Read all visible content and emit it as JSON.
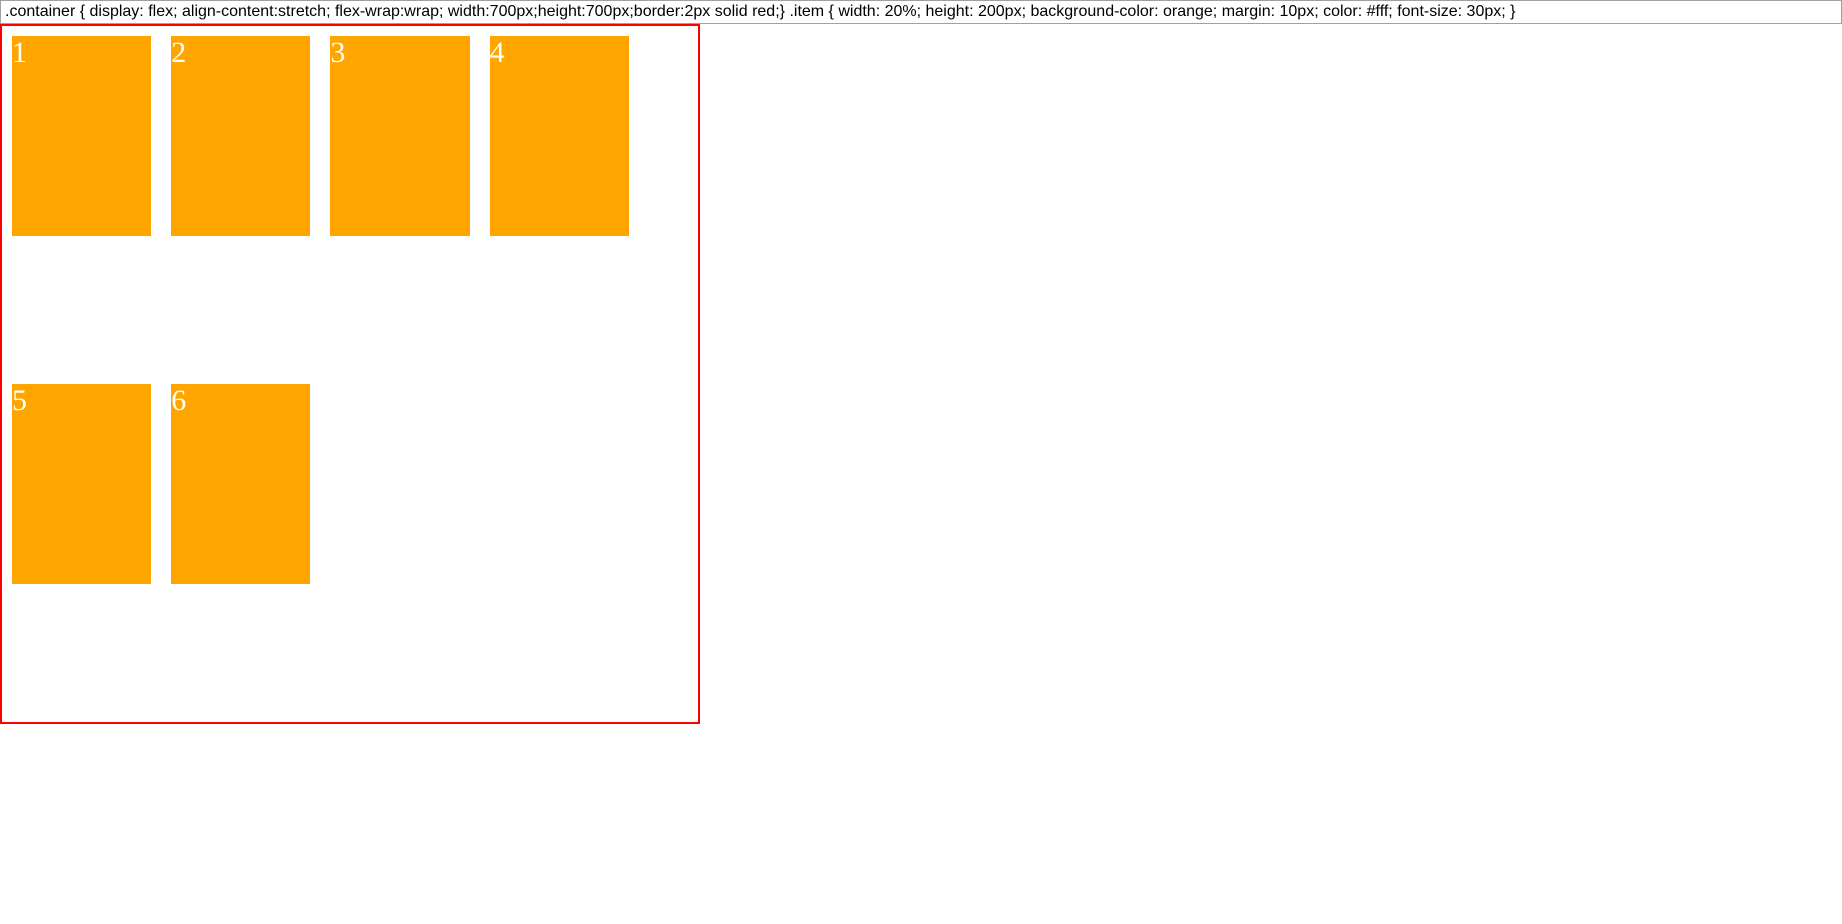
{
  "css_input": ".container { display: flex; align-content:stretch; flex-wrap:wrap; width:700px;height:700px;border:2px solid red;} .item { width: 20%; height: 200px; background-color: orange; margin: 10px; color: #fff; font-size: 30px; }",
  "items": {
    "0": "1",
    "1": "2",
    "2": "3",
    "3": "4",
    "4": "5",
    "5": "6"
  }
}
